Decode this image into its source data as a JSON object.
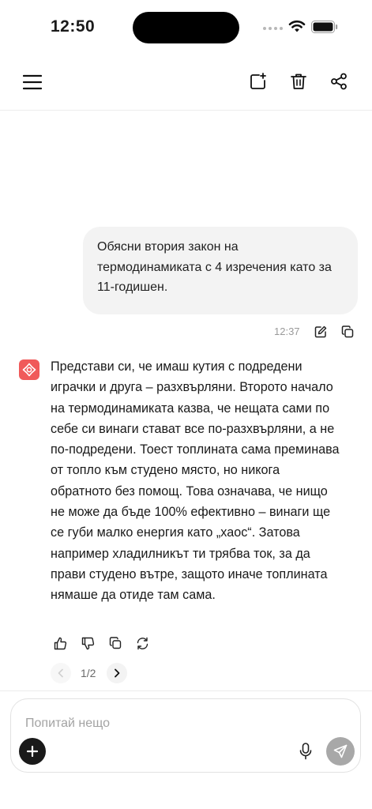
{
  "status_bar": {
    "time": "12:50",
    "icons": [
      "signal-dots-icon",
      "wifi-icon",
      "battery-icon"
    ]
  },
  "top_nav": {
    "icons": [
      "menu-icon",
      "new-chat-icon",
      "trash-icon",
      "share-icon"
    ]
  },
  "conversation": {
    "user_message": {
      "text": "Обясни втория закон на термодинамиката с 4 изречения като за 11-годишен.",
      "time": "12:37",
      "actions": [
        "edit-icon",
        "copy-icon"
      ]
    },
    "assistant_message": {
      "avatar_icon": "assistant-logo-icon",
      "text": "Представи си, че имаш кутия с подредени играчки и друга – разхвърляни. Второто начало на термодинамиката казва, че нещата сами по себе си винаги стават все по-разхвърляни, а не по-подредени. Тоест топлината сама преминава от топло към студено място, но никога обратното без помощ. Това означава, че нищо не може да бъде 100% ефективно – винаги ще се губи малко енергия като „хаос“. Затова например хладилникът ти трябва ток, за да прави студено вътре, защото иначе топлината нямаше да отиде там сама.",
      "actions": [
        "thumbs-up-icon",
        "thumbs-down-icon",
        "copy-icon",
        "regenerate-icon"
      ],
      "pager": {
        "current": 1,
        "total": 2,
        "label": "1/2"
      }
    }
  },
  "composer": {
    "placeholder": "Попитай нещо",
    "value": "",
    "icons": [
      "plus-icon",
      "microphone-icon",
      "send-icon"
    ]
  },
  "colors": {
    "accent": "#f05a5a",
    "bubble": "#f3f3f3",
    "send_disabled": "#a8a8a8",
    "text": "#1a1a1a",
    "muted": "#9a9a9a"
  }
}
